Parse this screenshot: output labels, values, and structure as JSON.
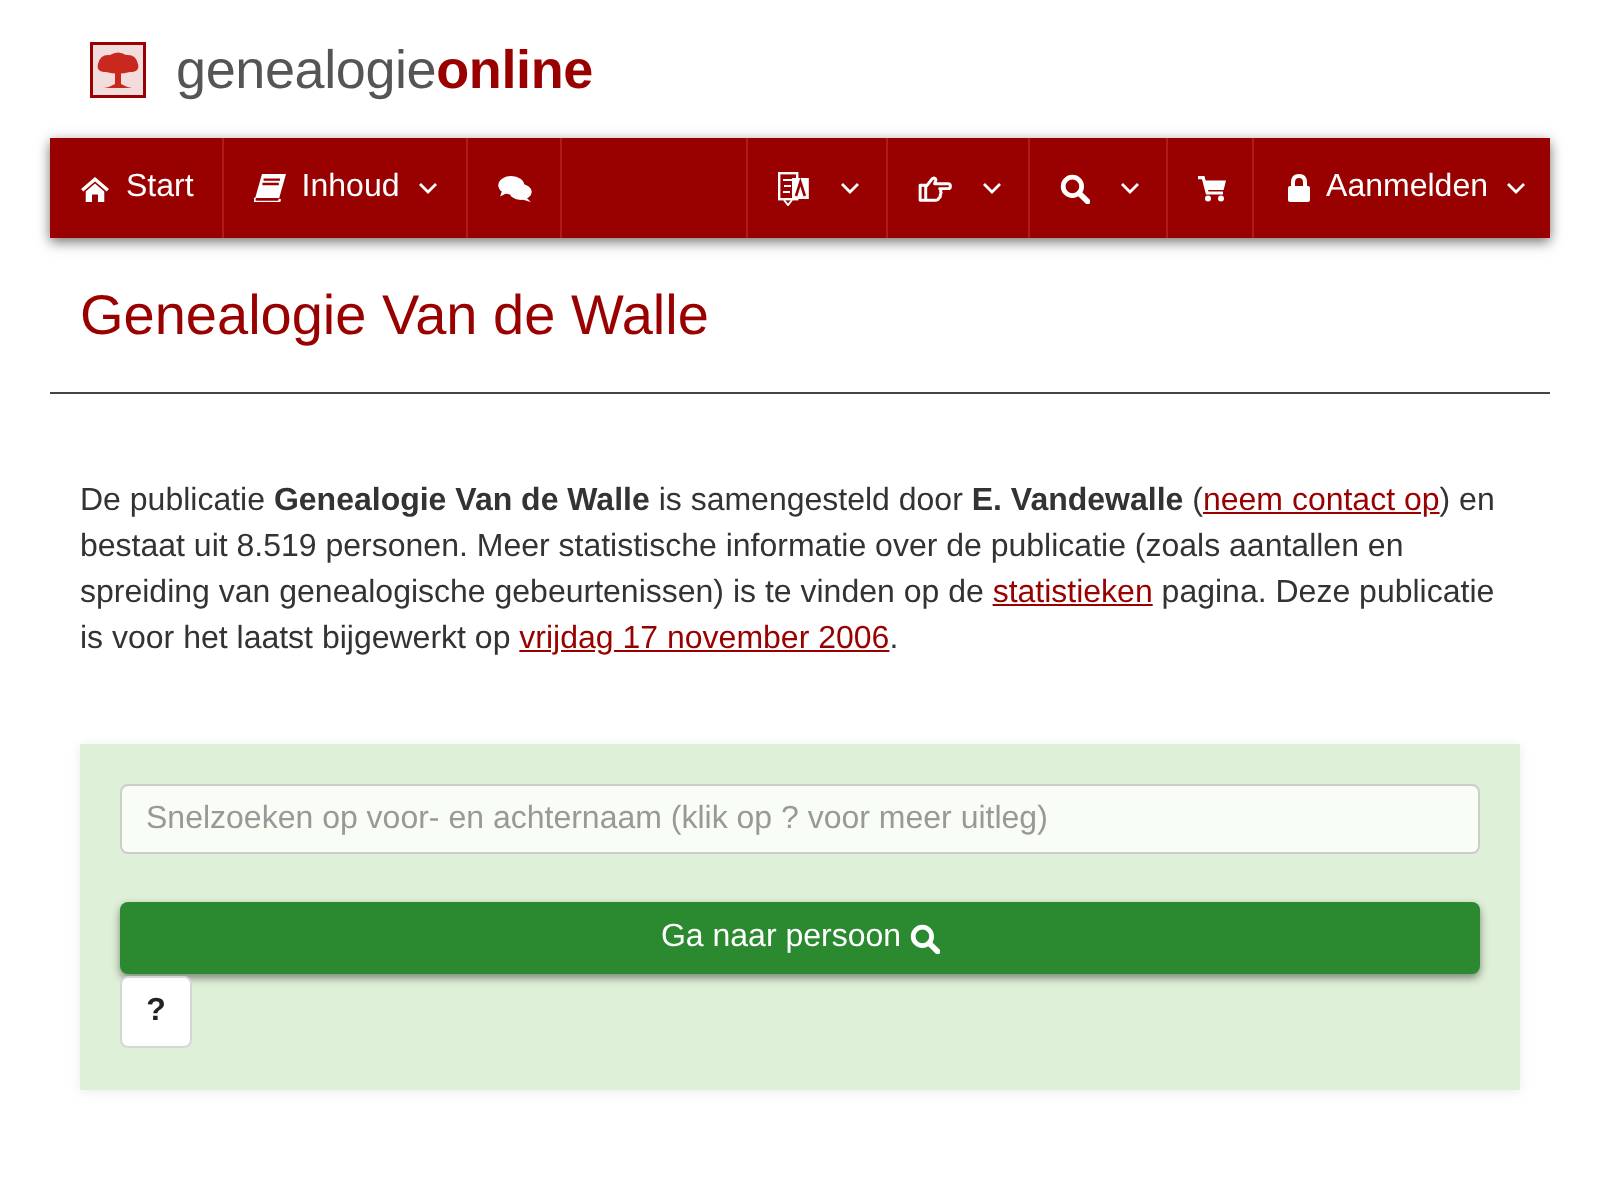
{
  "logo": {
    "text": "genealogie**online**"
  },
  "nav": {
    "left": [
      {
        "label": "Start",
        "dropdown": false
      },
      {
        "label": "Inhoud",
        "dropdown": true
      },
      {
        "dropdown": false
      }
    ],
    "right": [
      {
        "dropdown": true
      },
      {
        "dropdown": true
      },
      {
        "dropdown": true
      },
      {
        "dropdown": false
      },
      {
        "label": "Aanmelden",
        "dropdown": true
      }
    ]
  },
  "page_title": "Genealogie Van de Walle",
  "intro": {
    "parts": [
      {
        "kind": "text",
        "text": "De publicatie **Genealogie Van de Walle** is samengesteld door **E. Vandewalle** ("
      },
      {
        "kind": "link",
        "text": "neem contact op"
      },
      {
        "kind": "text",
        "text": ") en bestaat uit 8.519 personen. Meer statistische informatie over de publicatie (zoals aantallen en spreiding van genealogische gebeurtenissen) is te vinden op de "
      },
      {
        "kind": "link",
        "text": "statistieken"
      },
      {
        "kind": "text",
        "text": " pagina. Deze publicatie is voor het laatst bijgewerkt op "
      },
      {
        "kind": "link",
        "text": "vrijdag 17 november 2006"
      },
      {
        "kind": "text",
        "text": "."
      }
    ]
  },
  "quick_search": {
    "placeholder": "Snelzoeken op voor- en achternaam (klik op ? voor meer uitleg)",
    "button": "Ga naar persoon",
    "help_button": "?"
  }
}
